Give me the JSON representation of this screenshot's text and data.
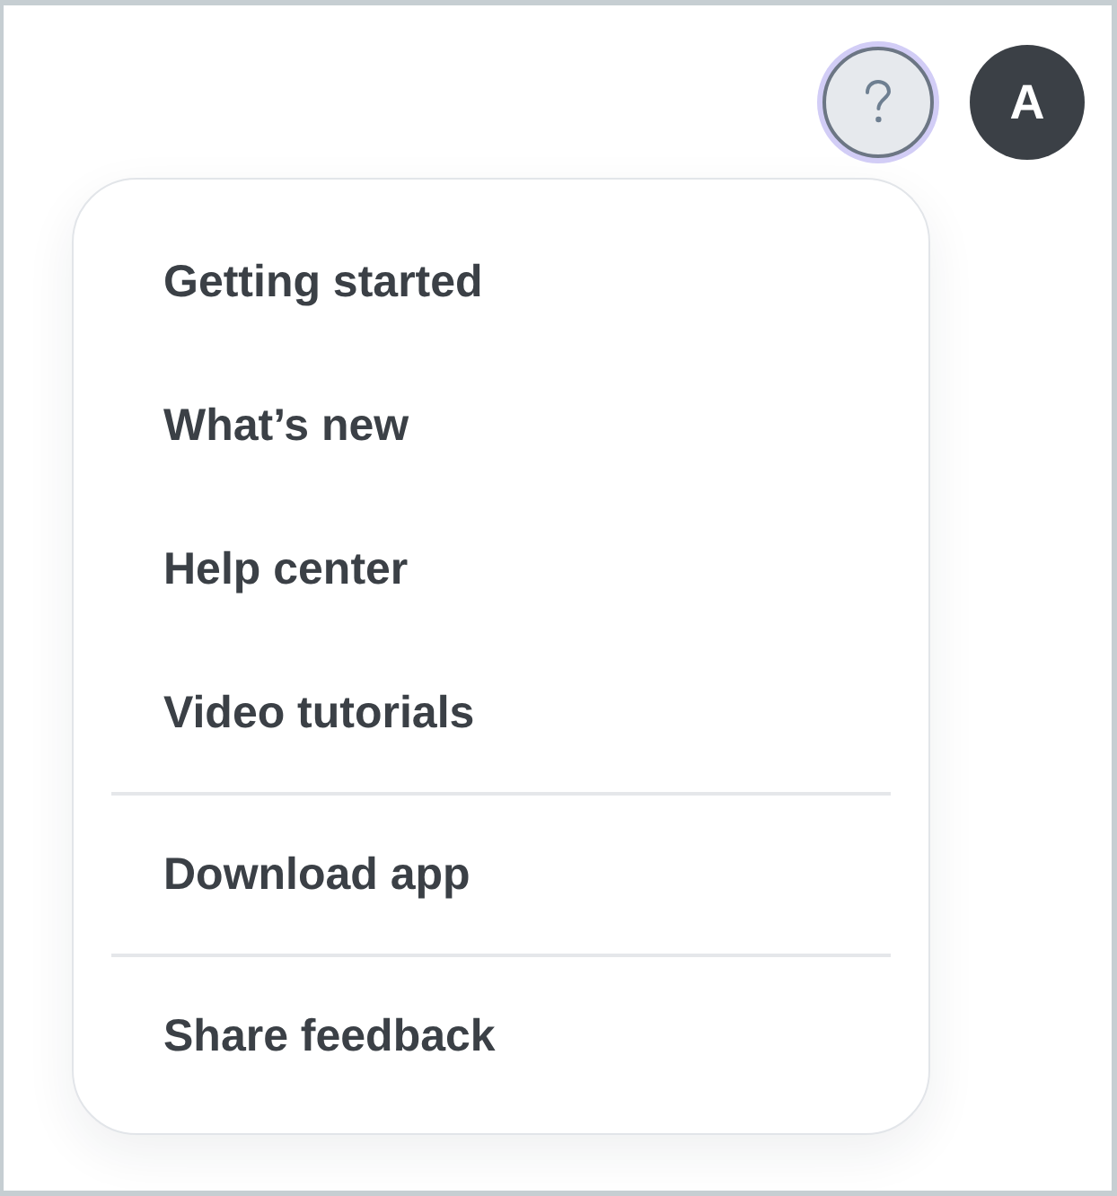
{
  "header": {
    "help_button": {
      "expanded": true
    },
    "avatar": {
      "initial": "A"
    }
  },
  "help_menu": {
    "sections": [
      {
        "items": [
          "Getting started",
          "What’s new",
          "Help center",
          "Video tutorials"
        ]
      },
      {
        "items": [
          "Download app"
        ]
      },
      {
        "items": [
          "Share feedback"
        ]
      }
    ]
  }
}
